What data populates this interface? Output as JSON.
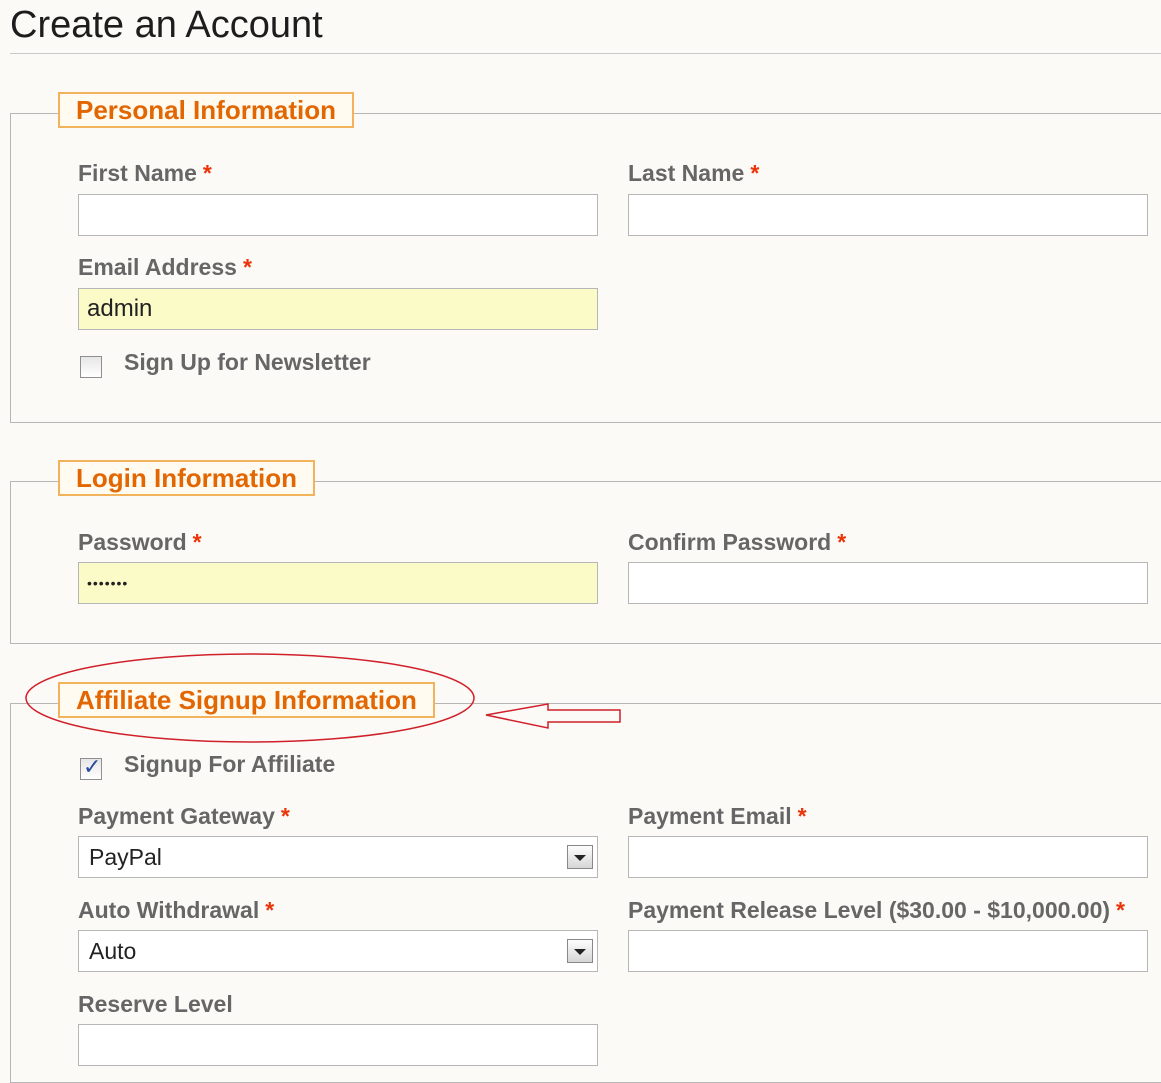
{
  "page": {
    "title": "Create an Account"
  },
  "personal": {
    "legend": "Personal Information",
    "first_name_label": "First Name",
    "first_name_value": "",
    "last_name_label": "Last Name",
    "last_name_value": "",
    "email_label": "Email Address",
    "email_value": "admin",
    "newsletter_label": "Sign Up for Newsletter",
    "newsletter_checked": false,
    "required_mark": "*"
  },
  "login": {
    "legend": "Login Information",
    "password_label": "Password",
    "password_value": "•••••••",
    "confirm_label": "Confirm Password",
    "confirm_value": "",
    "required_mark": "*"
  },
  "affiliate": {
    "legend": "Affiliate  Signup Information",
    "signup_label": "Signup For Affiliate",
    "signup_checked": true,
    "gateway_label": "Payment Gateway",
    "gateway_value": "PayPal",
    "payment_email_label": "Payment Email",
    "payment_email_value": "",
    "withdrawal_label": "Auto Withdrawal",
    "withdrawal_value": "Auto",
    "release_label": "Payment Release Level ($30.00 - $10,000.00)",
    "release_value": "",
    "reserve_label": "Reserve Level",
    "reserve_value": "",
    "required_mark": "*"
  },
  "colors": {
    "legend_text": "#e26703",
    "legend_border": "#f3b35c",
    "required": "#eb340a",
    "filled_input": "#fafbc6",
    "annotation": "#d0202a"
  }
}
